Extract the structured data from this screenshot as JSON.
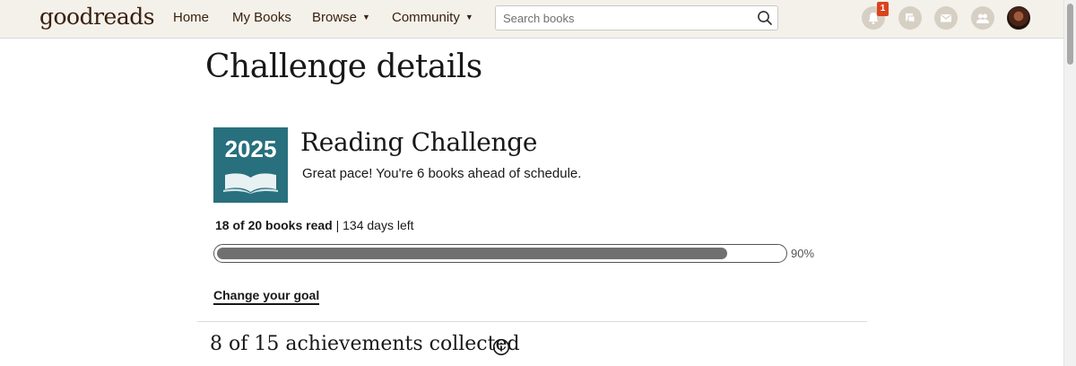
{
  "header": {
    "logo": "goodreads",
    "nav": [
      {
        "label": "Home"
      },
      {
        "label": "My Books"
      },
      {
        "label": "Browse",
        "dropdown": true
      },
      {
        "label": "Community",
        "dropdown": true
      }
    ],
    "search_placeholder": "Search books",
    "notification_count": "1",
    "icons": [
      "search-icon",
      "notifications-icon",
      "discussions-icon",
      "messages-icon",
      "friends-icon",
      "avatar"
    ]
  },
  "page": {
    "title": "Challenge details"
  },
  "challenge": {
    "year": "2025",
    "title": "Reading Challenge",
    "pace_message": "Great pace! You're 6 books ahead of schedule.",
    "books_read": "18 of 20 books read",
    "separator": " | ",
    "days_left": "134 days left",
    "progress_fraction": 0.9,
    "progress_percent_label": "90%",
    "change_goal_label": "Change your goal",
    "tile_color": "#28707d"
  },
  "achievements": {
    "summary": "8 of 15 achievements collected"
  },
  "colors": {
    "header_bg": "#f4f1ea",
    "brand": "#382110",
    "badge": "#d9441e",
    "progress_fill": "#707070"
  }
}
